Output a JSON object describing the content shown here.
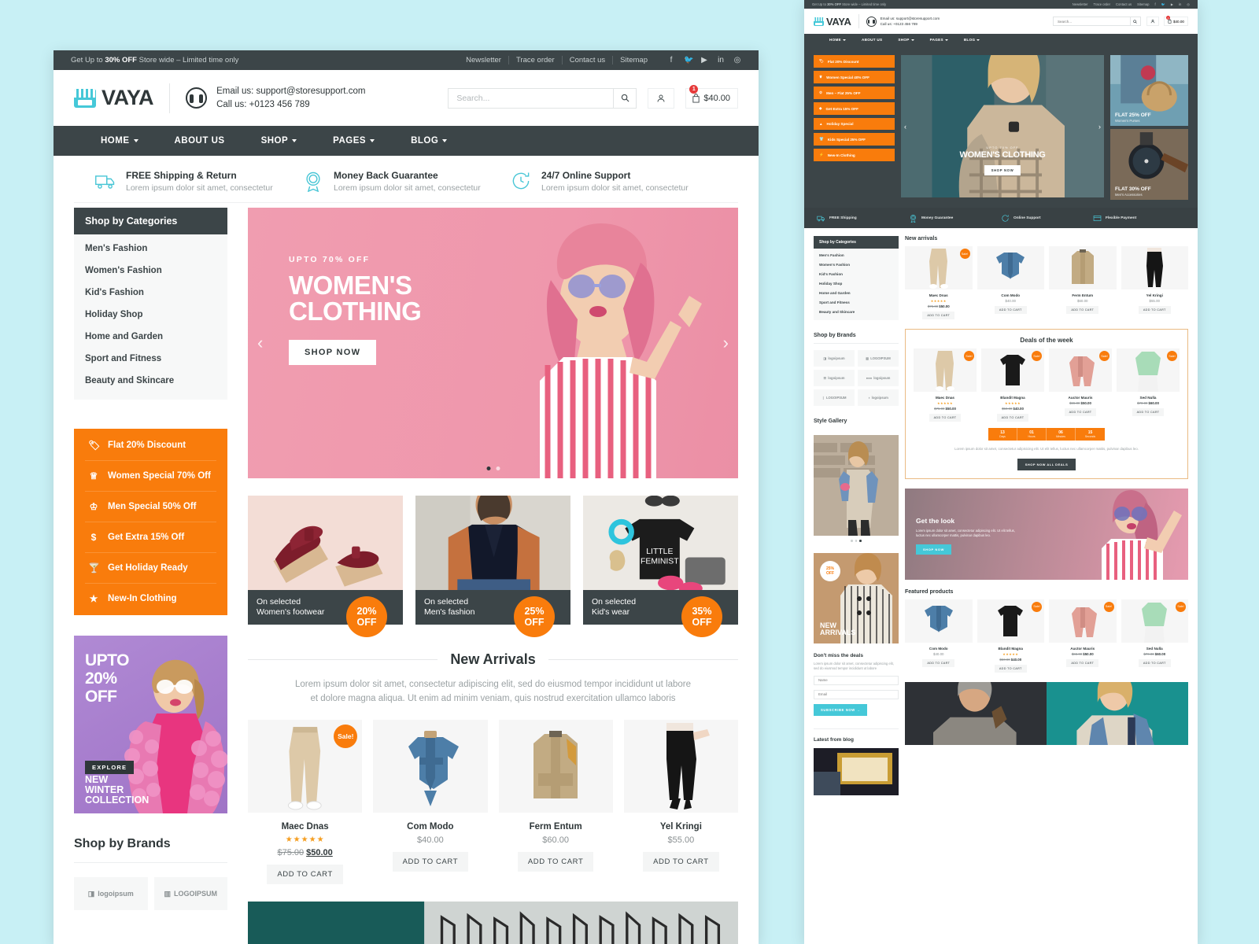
{
  "topbar": {
    "promo_prefix": "Get Up to ",
    "promo_bold": "30% OFF",
    "promo_suffix": " Store wide – Limited time only",
    "links": [
      "Newsletter",
      "Trace order",
      "Contact us",
      "Sitemap"
    ],
    "socials": [
      "facebook-icon",
      "twitter-icon",
      "youtube-icon",
      "linkedin-icon",
      "instagram-icon"
    ]
  },
  "header": {
    "logo": "VAYA",
    "email_line": "Email us: support@storesupport.com",
    "phone_line": "Call us: +0123 456 789",
    "search_placeholder": "Search...",
    "cart_total": "$40.00",
    "cart_count": "1"
  },
  "nav": [
    {
      "label": "HOME",
      "caret": true
    },
    {
      "label": "ABOUT US",
      "caret": false
    },
    {
      "label": "SHOP",
      "caret": true
    },
    {
      "label": "PAGES",
      "caret": true
    },
    {
      "label": "BLOG",
      "caret": true
    }
  ],
  "features": [
    {
      "title": "FREE Shipping & Return",
      "sub": "Lorem ipsum dolor sit amet, consectetur",
      "icon": "truck-icon"
    },
    {
      "title": "Money Back Guarantee",
      "sub": "Lorem ipsum dolor sit amet, consectetur",
      "icon": "badge-percent-icon"
    },
    {
      "title": "24/7 Online Support",
      "sub": "Lorem ipsum dolor sit amet, consectetur",
      "icon": "clock-24-icon"
    }
  ],
  "categories": {
    "title": "Shop by Categories",
    "items": [
      "Men's Fashion",
      "Women's Fashion",
      "Kid's Fashion",
      "Holiday Shop",
      "Home and Garden",
      "Sport and Fitness",
      "Beauty and Skincare"
    ]
  },
  "promo_list": [
    {
      "label": "Flat 20% Discount",
      "icon": "tag-icon"
    },
    {
      "label": "Women Special 70% Off",
      "icon": "crown-icon"
    },
    {
      "label": "Men Special 50% Off",
      "icon": "trophy-icon"
    },
    {
      "label": "Get Extra 15% Off",
      "icon": "dollar-icon"
    },
    {
      "label": "Get Holiday Ready",
      "icon": "cocktail-icon"
    },
    {
      "label": "New-In Clothing",
      "icon": "star-icon"
    }
  ],
  "side_banner": {
    "line1": "UPTO",
    "line2": "20%",
    "line3": "OFF",
    "explore": "EXPLORE",
    "bottom1": "NEW",
    "bottom2": "WINTER",
    "bottom3": "COLLECTION"
  },
  "brands": {
    "title": "Shop by Brands",
    "items": [
      "logoipsum",
      "LOGOIPSUM",
      "logoipsum",
      "logoipsum",
      "LOGOIPSUM",
      "logoipsum"
    ]
  },
  "hero": {
    "eyebrow": "UPTO 70% OFF",
    "title_line1": "WOMEN'S",
    "title_line2": "CLOTHING",
    "button": "SHOP NOW",
    "prev_icon": "chevron-left-icon",
    "next_icon": "chevron-right-icon",
    "dots": 2,
    "active_dot": 0
  },
  "promo_cards": [
    {
      "badge_pct": "20%",
      "badge_off": "OFF",
      "cap1": "On selected",
      "cap2": "Women's footwear"
    },
    {
      "badge_pct": "25%",
      "badge_off": "OFF",
      "cap1": "On selected",
      "cap2": "Men's fashion"
    },
    {
      "badge_pct": "35%",
      "badge_off": "OFF",
      "cap1": "On selected",
      "cap2": "Kid's wear"
    }
  ],
  "new_arrivals": {
    "title": "New Arrivals",
    "subtitle": "Lorem ipsum dolor sit amet, consectetur adipiscing elit, sed do eiusmod tempor incididunt ut labore et dolore magna aliqua. Ut enim ad minim veniam, quis nostrud exercitation ullamco laboris",
    "sale_badge": "Sale!",
    "add_to_cart": "ADD TO CART",
    "products": [
      {
        "name": "Maec Dnas",
        "stars": "★★★★★",
        "old_price": "$75.00",
        "price": "$50.00",
        "sale": true
      },
      {
        "name": "Com Modo",
        "stars": "",
        "old_price": "",
        "price": "$40.00",
        "sale": false
      },
      {
        "name": "Ferm Entum",
        "stars": "",
        "old_price": "",
        "price": "$60.00",
        "sale": false
      },
      {
        "name": "Yel Kringi",
        "stars": "",
        "old_price": "",
        "price": "$55.00",
        "sale": false
      }
    ]
  },
  "thumb": {
    "promo_list": [
      {
        "label": "Flat 20% Discount",
        "icon": "tag-icon"
      },
      {
        "label": "Women Special 40% OFF",
        "icon": "crown-icon"
      },
      {
        "label": "Men – Flat 25% OFF",
        "icon": "trophy-icon"
      },
      {
        "label": "Get Extra 15% OFF",
        "icon": "diamond-icon"
      },
      {
        "label": "Holiday Special",
        "icon": "tree-icon"
      },
      {
        "label": "Kids Special 25% OFF",
        "icon": "shirt-icon"
      },
      {
        "label": "New-In Clothing",
        "icon": "bolt-icon"
      }
    ],
    "hero": {
      "eyebrow": "UPTO 70% OFF",
      "title": "WOMEN'S CLOTHING",
      "button": "SHOP NOW"
    },
    "minis": [
      {
        "title": "FLAT 25% OFF",
        "sub": "Women's Purses"
      },
      {
        "title": "FLAT 30% OFF",
        "sub": "Men's Accessories"
      }
    ],
    "featbar": [
      {
        "label": "FREE Shipping",
        "icon": "truck-icon"
      },
      {
        "label": "Money Guarantee",
        "icon": "badge-percent-icon"
      },
      {
        "label": "Online Support",
        "icon": "clock-24-icon"
      },
      {
        "label": "Flexible Payment",
        "icon": "card-icon"
      }
    ],
    "new_arrivals_title": "New arrivals",
    "new_arrivals": [
      {
        "name": "Maec Dnas",
        "stars": "★★★★★",
        "old_price": "$75.00",
        "price": "$50.00",
        "sale": true
      },
      {
        "name": "Com Modo",
        "stars": "",
        "old_price": "",
        "price": "$40.00",
        "sale": false
      },
      {
        "name": "Ferm Entum",
        "stars": "",
        "old_price": "",
        "price": "$60.00",
        "sale": false
      },
      {
        "name": "Yel Kringi",
        "stars": "",
        "old_price": "",
        "price": "$55.00",
        "sale": false
      }
    ],
    "deals": {
      "title": "Deals of the week",
      "products": [
        {
          "name": "Maec Dnas",
          "stars": "★★★★★",
          "old_price": "$75.00",
          "price": "$50.00",
          "sale": true
        },
        {
          "name": "Blandit Magna",
          "stars": "★★★★★",
          "old_price": "$50.00",
          "price": "$40.00",
          "sale": true
        },
        {
          "name": "Auctor Mauris",
          "stars": "",
          "old_price": "$65.00",
          "price": "$50.00",
          "sale": true
        },
        {
          "name": "Sed Nulla",
          "stars": "",
          "old_price": "$70.00",
          "price": "$60.00",
          "sale": true
        }
      ],
      "timer": [
        {
          "value": "13",
          "label": "Days"
        },
        {
          "value": "01",
          "label": "Hours"
        },
        {
          "value": "06",
          "label": "Minutes"
        },
        {
          "value": "15",
          "label": "Seconds"
        }
      ],
      "text": "Lorem ipsum dolor sit amet, consectetur adipisicing elit. Ut elit tellus, luctus nec ullamcorper mattis, pulvinar dapibus leo.",
      "button": "SHOP NOW ALL DEALS"
    },
    "get_look": {
      "title": "Get the look",
      "text": "Lorem ipsum dolor sit amet, consectetur adipiscing elit. Ut elit tellus, luctus nec ullamcorper mattis, pulvinar dapibus leo.",
      "button": "SHOP NOW"
    },
    "featured_title": "Featured products",
    "featured": [
      {
        "name": "Com Modo",
        "stars": "",
        "old_price": "",
        "price": "$40.00",
        "sale": false
      },
      {
        "name": "Blandit Magna",
        "stars": "★★★★★",
        "old_price": "$50.00",
        "price": "$40.00",
        "sale": true
      },
      {
        "name": "Auctor Mauris",
        "stars": "",
        "old_price": "$65.00",
        "price": "$50.00",
        "sale": true
      },
      {
        "name": "Sed Nulla",
        "stars": "",
        "old_price": "$70.00",
        "price": "$60.00",
        "sale": true
      }
    ],
    "style_gallery_title": "Style Gallery",
    "new_arrivals_banner": {
      "badge1": "25%",
      "badge2": "OFF",
      "line1": "NEW",
      "line2": "ARRIVALS"
    },
    "newsletter": {
      "title": "Don't miss the deals",
      "text": "Lorem ipsum dolor sit amet, consectetur adipiscing elit, sed do eiusmod tempor incididunt ut labore",
      "name_placeholder": "Name",
      "email_placeholder": "Email",
      "button": "SUBSCRIBE NOW →"
    },
    "blog_title": "Latest from blog",
    "add_to_cart": "ADD TO CART",
    "sale_badge": "Sale!"
  },
  "colors": {
    "dark": "#3c4548",
    "orange": "#f97c0c",
    "teal": "#45c8d8",
    "pink": "#ef97ac",
    "purple": "#a87fce"
  }
}
